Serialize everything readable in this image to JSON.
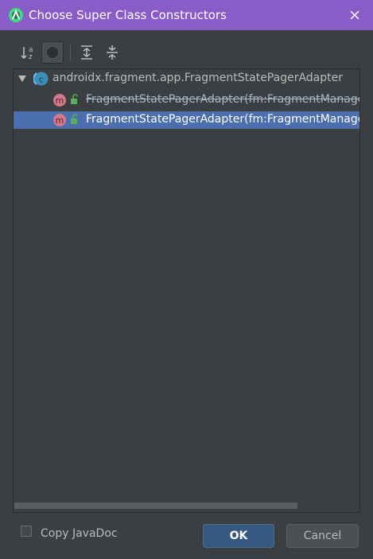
{
  "window": {
    "title": "Choose Super Class Constructors"
  },
  "toolbar": {
    "sort_icon": "sort-alphabetically-icon",
    "toggle_icon": "show-inherited-icon",
    "expand_icon": "expand-all-icon",
    "collapse_icon": "collapse-all-icon"
  },
  "tree": {
    "root": {
      "label": "androidx.fragment.app.FragmentStatePagerAdapter",
      "icon": "class-icon"
    },
    "items": [
      {
        "label": "FragmentStatePagerAdapter(fm:FragmentManager",
        "icon": "method-icon",
        "deprecated": true,
        "selected": false
      },
      {
        "label": "FragmentStatePagerAdapter(fm:FragmentManager,",
        "icon": "method-icon",
        "deprecated": false,
        "selected": true
      }
    ]
  },
  "options": {
    "copy_javadoc_label": "Copy JavaDoc",
    "copy_javadoc_checked": false
  },
  "buttons": {
    "ok": "OK",
    "cancel": "Cancel"
  },
  "colors": {
    "titlebar": "#8a5cc8",
    "background": "#3c3f41",
    "selection": "#4b6eaf",
    "ok_button": "#365880"
  }
}
